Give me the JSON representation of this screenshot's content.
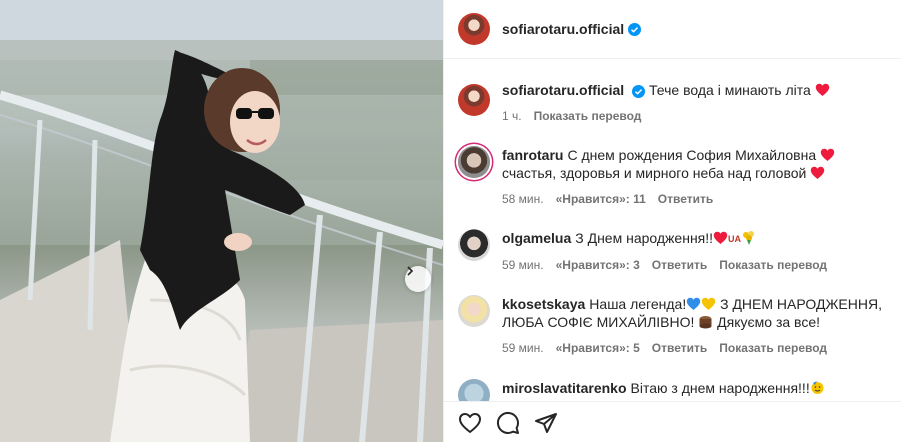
{
  "post": {
    "username": "sofiarotaru.official",
    "caption": "Тече вода і минають літа",
    "time": "1 ч.",
    "translate": "Показать перевод"
  },
  "comments": [
    {
      "username": "fanrotaru",
      "text_a": "С днем рождения София Михайловна",
      "text_b": "счастья, здоровья и мирного неба над головой",
      "time": "58 мин.",
      "likes": "«Нравится»: 11",
      "reply": "Ответить"
    },
    {
      "username": "olgamelua",
      "text": "З Днем народження!!",
      "flag": "UA",
      "time": "59 мин.",
      "likes": "«Нравится»: 3",
      "reply": "Ответить",
      "translate": "Показать перевод"
    },
    {
      "username": "kkosetskaya",
      "text_a": "Наша легенда!",
      "text_b": "З ДНЕМ НАРОДЖЕННЯ, ЛЮБА СОФІЄ МИХАЙЛІВНО!",
      "text_c": "Дякуємо за все!",
      "time": "59 мин.",
      "likes": "«Нравится»: 5",
      "reply": "Ответить",
      "translate": "Показать перевод"
    },
    {
      "username": "miroslavatitarenko",
      "text": "Вітаю з днем народження!!!"
    }
  ],
  "icons": [
    "heart-icon",
    "comment-icon",
    "share-icon",
    "verified-badge-icon",
    "chevron-right-icon"
  ],
  "colors": {
    "verified": "#0095f6",
    "heart": "#ed1c3f",
    "meta": "#737373",
    "text": "#262626"
  }
}
